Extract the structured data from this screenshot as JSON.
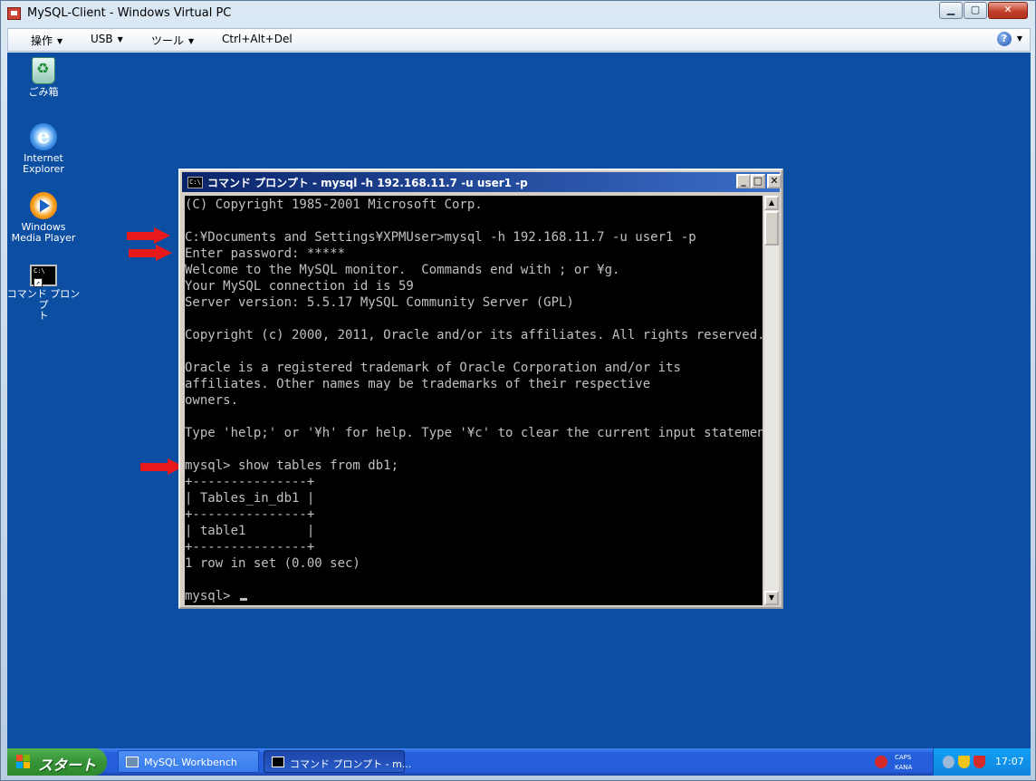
{
  "host_window": {
    "title": "MySQL-Client - Windows Virtual PC",
    "controls": {
      "minimize": "▁",
      "maximize": "▢",
      "close": "✕"
    },
    "menu": [
      {
        "label": "操作"
      },
      {
        "label": "USB"
      },
      {
        "label": "ツール"
      },
      {
        "label": "Ctrl+Alt+Del"
      }
    ],
    "help_icon": "?"
  },
  "desktop": {
    "background": "#0c4ea2",
    "icons": [
      {
        "label": "ごみ箱",
        "icon": "recycle-bin-icon"
      },
      {
        "label_line1": "Internet",
        "label_line2": "Explorer",
        "icon": "internet-explorer-icon"
      },
      {
        "label_line1": "Windows",
        "label_line2": "Media Player",
        "icon": "media-player-icon"
      },
      {
        "label_line1": "コマンド プロンプ",
        "label_line2": "ト",
        "icon": "command-prompt-icon"
      }
    ]
  },
  "cmd_window": {
    "icon_text": "C:\\",
    "title": "コマンド プロンプト - mysql -h 192.168.11.7 -u user1 -p",
    "controls": {
      "minimize": "_",
      "maximize": "□",
      "close": "✕"
    },
    "lines": [
      "(C) Copyright 1985-2001 Microsoft Corp.",
      "",
      "C:¥Documents and Settings¥XPMUser>mysql -h 192.168.11.7 -u user1 -p",
      "Enter password: *****",
      "Welcome to the MySQL monitor.  Commands end with ; or ¥g.",
      "Your MySQL connection id is 59",
      "Server version: 5.5.17 MySQL Community Server (GPL)",
      "",
      "Copyright (c) 2000, 2011, Oracle and/or its affiliates. All rights reserved.",
      "",
      "Oracle is a registered trademark of Oracle Corporation and/or its",
      "affiliates. Other names may be trademarks of their respective",
      "owners.",
      "",
      "Type 'help;' or '¥h' for help. Type '¥c' to clear the current input statement.",
      "",
      "mysql> show tables from db1;",
      "+---------------+",
      "| Tables_in_db1 |",
      "+---------------+",
      "| table1        |",
      "+---------------+",
      "1 row in set (0.00 sec)",
      "",
      "mysql> "
    ],
    "console_colors": {
      "background": "#000000",
      "text": "#c0c0c0"
    }
  },
  "annotations": {
    "arrow_color": "#e8191b"
  },
  "taskbar": {
    "start_label": "スタート",
    "buttons": [
      {
        "label": "MySQL Workbench",
        "active": false
      },
      {
        "label": "コマンド プロンプト - m...",
        "active": true
      }
    ],
    "ime_caps": "CAPS",
    "ime_kana": "KANA",
    "clock": "17:07"
  }
}
